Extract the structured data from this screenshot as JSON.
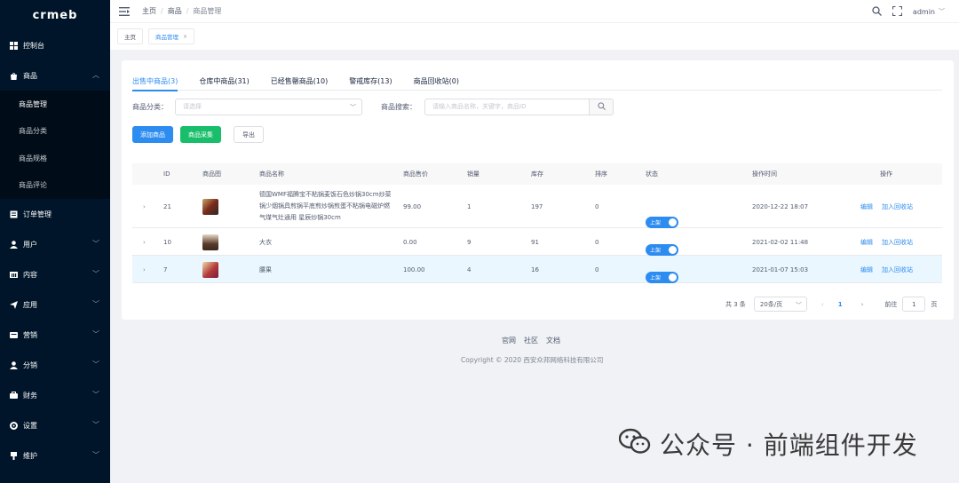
{
  "brand": {
    "logo_text": "crmeb"
  },
  "sidebar": {
    "items": [
      {
        "label": "控制台",
        "icon": "dashboard-icon"
      },
      {
        "label": "商品",
        "icon": "shop-icon",
        "expanded": true,
        "children": [
          {
            "label": "商品管理",
            "active": true
          },
          {
            "label": "商品分类"
          },
          {
            "label": "商品规格"
          },
          {
            "label": "商品评论"
          }
        ]
      },
      {
        "label": "订单管理",
        "icon": "order-icon"
      },
      {
        "label": "用户",
        "icon": "user-icon"
      },
      {
        "label": "内容",
        "icon": "content-icon"
      },
      {
        "label": "应用",
        "icon": "send-icon"
      },
      {
        "label": "营销",
        "icon": "marketing-icon"
      },
      {
        "label": "分销",
        "icon": "distribution-icon"
      },
      {
        "label": "财务",
        "icon": "finance-icon"
      },
      {
        "label": "设置",
        "icon": "gear-icon"
      },
      {
        "label": "维护",
        "icon": "maintain-icon"
      }
    ]
  },
  "header": {
    "breadcrumb": [
      "主页",
      "商品",
      "商品管理"
    ],
    "user": "admin"
  },
  "tags": [
    {
      "label": "主页"
    },
    {
      "label": "商品管理",
      "close": "×"
    }
  ],
  "tabs": [
    {
      "label": "出售中商品(3)",
      "active": true
    },
    {
      "label": "仓库中商品(31)"
    },
    {
      "label": "已经售罄商品(10)"
    },
    {
      "label": "警戒库存(13)"
    },
    {
      "label": "商品回收站(0)"
    }
  ],
  "filter": {
    "category_label": "商品分类：",
    "category_placeholder": "请选择",
    "search_label": "商品搜索：",
    "search_placeholder": "请输入商品名称，关键字，商品ID"
  },
  "actions": {
    "add": "添加商品",
    "collect": "商品采集",
    "export": "导出"
  },
  "table": {
    "headers": [
      "ID",
      "商品图",
      "商品名称",
      "商品售价",
      "销量",
      "库存",
      "排序",
      "状态",
      "操作时间",
      "操作"
    ],
    "rows": [
      {
        "id": "21",
        "name": "德国WMF福腾宝不粘锅麦饭石色炒锅30cm炒菜锅少烟锅具煎锅平底煎炒锅煎蛋不粘锅电磁炉燃气煤气灶通用 星辰炒锅30cm",
        "price": "99.00",
        "sales": "1",
        "stock": "197",
        "sort": "0",
        "status": "上架",
        "time": "2020-12-22 18:07",
        "edit": "编辑",
        "recycle": "加入回收站"
      },
      {
        "id": "10",
        "name": "大衣",
        "price": "0.00",
        "sales": "9",
        "stock": "91",
        "sort": "0",
        "status": "上架",
        "time": "2021-02-02 11:48",
        "edit": "编辑",
        "recycle": "加入回收站"
      },
      {
        "id": "7",
        "name": "腰果",
        "price": "100.00",
        "sales": "4",
        "stock": "16",
        "sort": "0",
        "status": "上架",
        "time": "2021-01-07 15:03",
        "edit": "编辑",
        "recycle": "加入回收站"
      }
    ]
  },
  "pagination": {
    "total": "共 3 条",
    "page_size": "20条/页",
    "current": "1",
    "jump_label": "前往",
    "jump_value": "1",
    "jump_suffix": "页"
  },
  "footer": {
    "links": [
      "官网",
      "社区",
      "文档"
    ],
    "copyright": "Copyright © 2020 西安众邦网络科技有限公司"
  },
  "watermark": "公众号 · 前端组件开发",
  "colors": {
    "sidebar": "#001529",
    "primary": "#2d8cf0",
    "success": "#19be6b"
  }
}
